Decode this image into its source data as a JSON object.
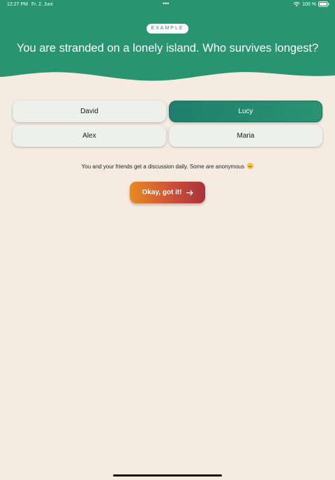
{
  "status_bar": {
    "time": "12:27 PM",
    "date": "Fr. 2. Juni",
    "dots": "•••",
    "battery": "100 %",
    "icons": [
      "wifi-icon",
      "battery-icon"
    ]
  },
  "header": {
    "badge": "EXAMPLE",
    "question": "You are stranded on a lonely island. Who survives longest?"
  },
  "answers": [
    {
      "label": "David",
      "selected": false
    },
    {
      "label": "Lucy",
      "selected": true
    },
    {
      "label": "Alex",
      "selected": false
    },
    {
      "label": "Maria",
      "selected": false
    }
  ],
  "info_text": "You and your friends get a discussion daily. Some are anonymous",
  "cta": {
    "label": "Okay, got it!",
    "icon": "arrow-right-icon"
  },
  "colors": {
    "header_green": "#2a9370",
    "background": "#f5ebe1",
    "selected": "#1f7e6e",
    "cta_start": "#e88a22",
    "cta_end": "#a8343a"
  }
}
